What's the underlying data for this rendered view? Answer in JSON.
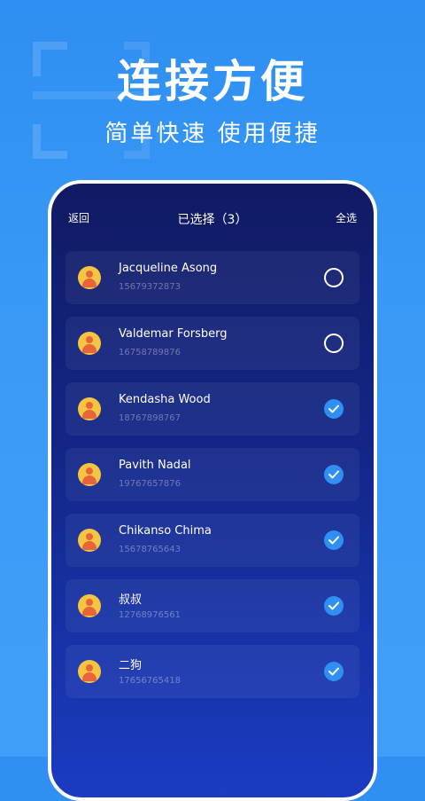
{
  "headline": "连接方便",
  "subline": "简单快速 使用便捷",
  "nav": {
    "back_label": "返回",
    "title": "已选择（3）",
    "select_all_label": "全选"
  },
  "contacts": [
    {
      "name": "Jacqueline Asong",
      "phone": "15679372873",
      "selected": false
    },
    {
      "name": "Valdemar Forsberg",
      "phone": "16758789876",
      "selected": false
    },
    {
      "name": "Kendasha Wood",
      "phone": "18767898767",
      "selected": true
    },
    {
      "name": "Pavith Nadal",
      "phone": "19767657876",
      "selected": true
    },
    {
      "name": "Chikanso Chima",
      "phone": "15678765643",
      "selected": true
    },
    {
      "name": "叔叔",
      "phone": "12768976561",
      "selected": true
    },
    {
      "name": "二狗",
      "phone": "17656765418",
      "selected": true
    }
  ],
  "colors": {
    "accent": "#2f8ff2",
    "avatar_bg": "#f5c542",
    "avatar_fg": "#e8643a"
  },
  "icons": {
    "avatar": "person-avatar-icon",
    "selected": "checkmark-icon",
    "unselected": "empty-circle-icon"
  }
}
